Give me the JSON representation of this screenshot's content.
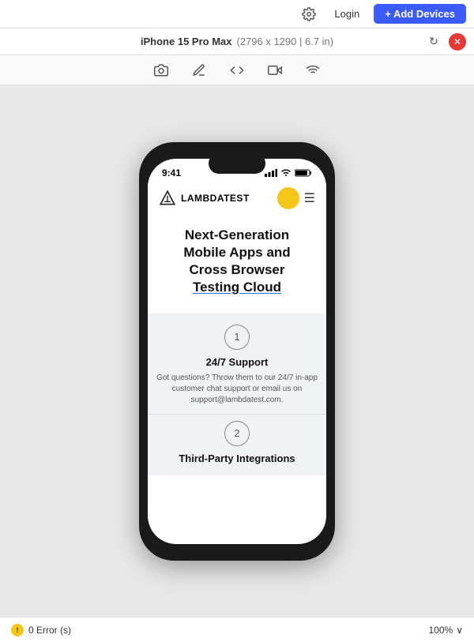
{
  "topbar": {
    "login_label": "Login",
    "add_devices_label": "+ Add Devices",
    "gear_icon": "⚙"
  },
  "device_bar": {
    "device_name": "iPhone 15 Pro Max",
    "device_detail": "(2796 x 1290 | 6.7 in)",
    "refresh_icon": "↻",
    "close_icon": "✕"
  },
  "toolbar": {
    "icons": [
      {
        "name": "camera-icon",
        "symbol": "📷"
      },
      {
        "name": "pen-icon",
        "symbol": "✏"
      },
      {
        "name": "code-icon",
        "symbol": "</>"
      },
      {
        "name": "video-icon",
        "symbol": "▶"
      },
      {
        "name": "wifi-icon",
        "symbol": "≋"
      }
    ]
  },
  "phone": {
    "status_bar": {
      "time": "9:41",
      "signal": "▌▌▌",
      "wifi": "wifi",
      "battery": "▐"
    },
    "nav": {
      "logo_text": "LAMBDATEST",
      "menu_icon": "☰"
    },
    "hero": {
      "line1": "Next-Generation",
      "line2": "Mobile Apps and",
      "line3": "Cross Browser",
      "line4": "Testing Cloud"
    },
    "feature1": {
      "number": "1",
      "title": "24/7 Support",
      "desc": "Got questions? Throw them to our 24/7 in-app customer chat support or email us on support@lambdatest.com."
    },
    "feature2": {
      "number": "2",
      "title": "Third-Party Integrations"
    }
  },
  "bottom_bar": {
    "error_count": "0 Error (s)",
    "zoom_level": "100%",
    "chevron_icon": "∨"
  }
}
